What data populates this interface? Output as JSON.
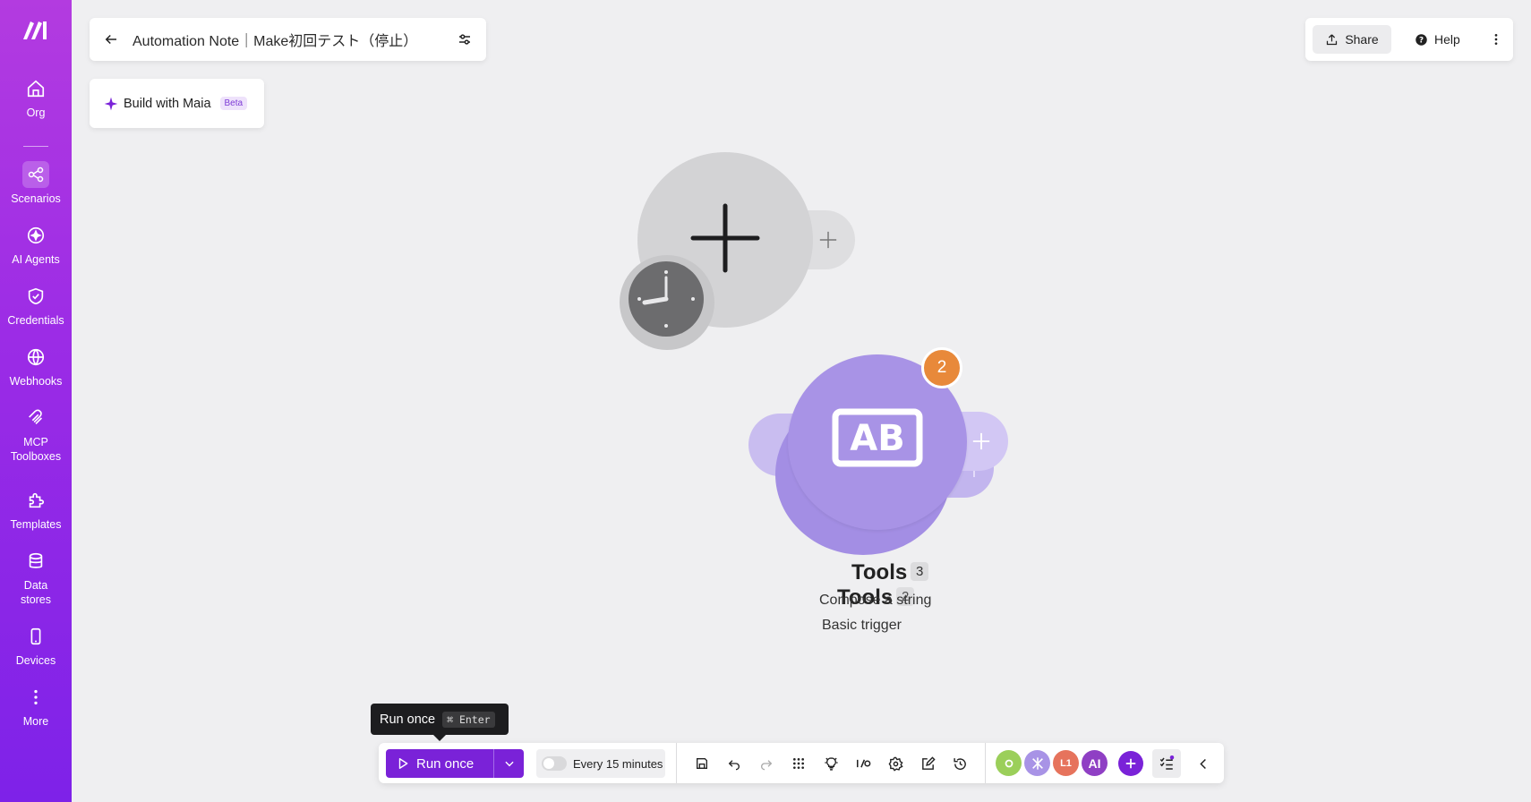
{
  "sidebar": {
    "items": [
      {
        "label": "Org",
        "icon": "home-icon"
      },
      {
        "label": "Scenarios",
        "icon": "share-nodes-icon",
        "active": true
      },
      {
        "label": "AI Agents",
        "icon": "sparkle-icon"
      },
      {
        "label": "Credentials",
        "icon": "shield-check-icon"
      },
      {
        "label": "Webhooks",
        "icon": "globe-icon"
      },
      {
        "label": "MCP",
        "label2": "Toolboxes",
        "icon": "mcp-icon"
      },
      {
        "label": "Templates",
        "icon": "puzzle-icon"
      },
      {
        "label": "Data",
        "label2": "stores",
        "icon": "database-icon"
      },
      {
        "label": "Devices",
        "icon": "device-icon"
      },
      {
        "label": "More",
        "icon": "dots-vertical-icon"
      }
    ]
  },
  "header": {
    "title": "Automation Note｜Make初回テスト（停止）"
  },
  "maia": {
    "label": "Build with Maia",
    "badge": "Beta"
  },
  "top_right": {
    "share_label": "Share",
    "help_label": "Help"
  },
  "canvas": {
    "tools_node": {
      "count_badge": "2",
      "label_front": "Tools",
      "num_front": "3",
      "sub_front": "Compose a string",
      "label_back": "Tools",
      "num_back": "2",
      "sub_back": "Basic trigger"
    }
  },
  "tooltip": {
    "text": "Run once",
    "shortcut_cmd": "⌘",
    "shortcut_key": "Enter"
  },
  "toolbar": {
    "run_label": "Run once",
    "schedule_label": "Every 15 minutes",
    "schedule_enabled": false,
    "apps": [
      {
        "name": "app-green",
        "color": "#9bcf5a"
      },
      {
        "name": "app-tools",
        "color": "#a893e6"
      },
      {
        "name": "app-l1",
        "color": "#e6735c",
        "text": "L1"
      },
      {
        "name": "app-ai",
        "color": "#8f3fc4",
        "text": "AI"
      }
    ]
  },
  "colors": {
    "brand_purple": "#7a22d8",
    "tools_purple": "#a893e6",
    "badge_orange": "#e8893a"
  }
}
